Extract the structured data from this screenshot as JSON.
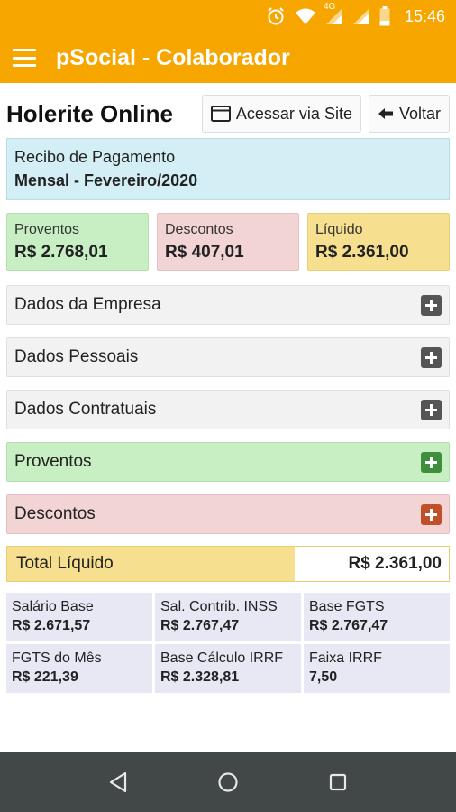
{
  "status": {
    "time": "15:46",
    "network": "4G",
    "icons": [
      "alarm-icon",
      "wifi-icon",
      "signal-icon",
      "signal-icon",
      "battery-icon"
    ]
  },
  "appbar": {
    "title": "pSocial - Colaborador",
    "menu_icon": "hamburger-menu-icon"
  },
  "header": {
    "title": "Holerite Online",
    "site_button": "Acessar via Site",
    "back_button": "Voltar"
  },
  "receipt": {
    "label": "Recibo de Pagamento",
    "period": "Mensal - Fevereiro/2020"
  },
  "summary": {
    "proventos": {
      "label": "Proventos",
      "value": "R$ 2.768,01"
    },
    "descontos": {
      "label": "Descontos",
      "value": "R$ 407,01"
    },
    "liquido": {
      "label": "Líquido",
      "value": "R$ 2.361,00"
    }
  },
  "sections": [
    {
      "title": "Dados da Empresa"
    },
    {
      "title": "Dados Pessoais"
    },
    {
      "title": "Dados Contratuais"
    },
    {
      "title": "Proventos"
    },
    {
      "title": "Descontos"
    }
  ],
  "total": {
    "label": "Total Líquido",
    "value": "R$ 2.361,00"
  },
  "bases": [
    {
      "label": "Salário Base",
      "value": "R$ 2.671,57"
    },
    {
      "label": "Sal. Contrib. INSS",
      "value": "R$ 2.767,47"
    },
    {
      "label": "Base FGTS",
      "value": "R$ 2.767,47"
    },
    {
      "label": "FGTS do Mês",
      "value": "R$ 221,39"
    },
    {
      "label": "Base Cálculo IRRF",
      "value": "R$ 2.328,81"
    },
    {
      "label": "Faixa IRRF",
      "value": "7,50"
    }
  ],
  "colors": {
    "accent": "#F7A600",
    "section_plus_gray": "#555555",
    "section_plus_green": "#3E8E3E",
    "section_plus_red": "#C0502A",
    "navbar": "#424848"
  }
}
